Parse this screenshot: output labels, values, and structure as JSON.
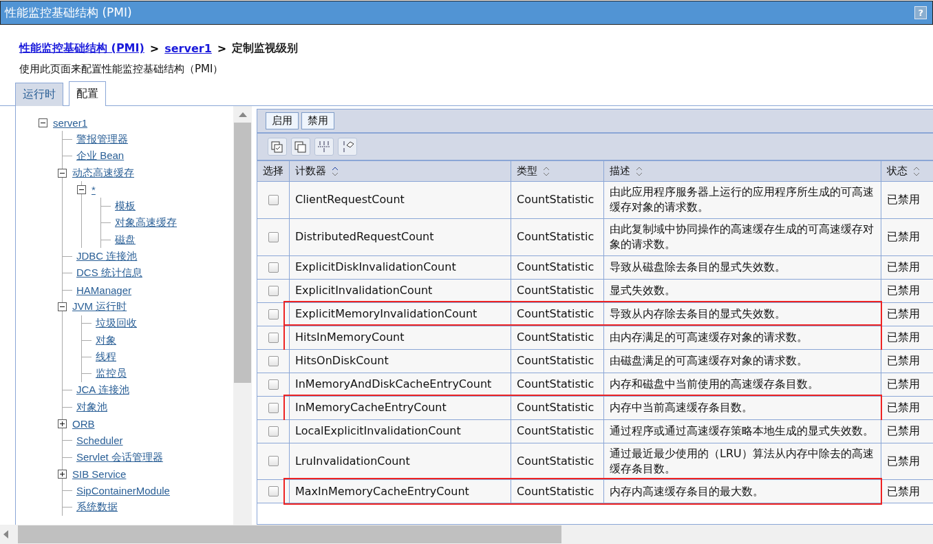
{
  "window": {
    "title": "性能监控基础结构 (PMI)",
    "help": "?"
  },
  "breadcrumb": [
    {
      "label": "性能监控基础结构 (PMI)",
      "link": true
    },
    {
      "label": "server1",
      "link": true
    },
    {
      "label": "定制监视级别",
      "link": false
    }
  ],
  "breadcrumb_separator": ">",
  "description": "使用此页面来配置性能监控基础结构（PMI）",
  "tabs": [
    {
      "label": "运行时",
      "selected": false
    },
    {
      "label": "配置",
      "selected": true
    }
  ],
  "tree": [
    {
      "label": "server1",
      "expanded": true,
      "children": [
        {
          "label": "警报管理器"
        },
        {
          "label": "企业 Bean"
        },
        {
          "label": "动态高速缓存",
          "expanded": true,
          "children": [
            {
              "label": "*",
              "expanded": true,
              "children": [
                {
                  "label": "模板"
                },
                {
                  "label": "对象高速缓存"
                },
                {
                  "label": "磁盘"
                }
              ]
            }
          ]
        },
        {
          "label": "JDBC 连接池"
        },
        {
          "label": "DCS 统计信息"
        },
        {
          "label": "HAManager"
        },
        {
          "label": "JVM 运行时",
          "expanded": true,
          "children": [
            {
              "label": "垃圾回收"
            },
            {
              "label": "对象"
            },
            {
              "label": "线程"
            },
            {
              "label": "监控员"
            }
          ]
        },
        {
          "label": "JCA 连接池"
        },
        {
          "label": "对象池"
        },
        {
          "label": "ORB",
          "expanded": false
        },
        {
          "label": "Scheduler"
        },
        {
          "label": "Servlet 会话管理器"
        },
        {
          "label": "SIB Service",
          "expanded": false
        },
        {
          "label": "SipContainerModule"
        },
        {
          "label": "系统数据"
        }
      ]
    }
  ],
  "buttons": [
    "启用",
    "禁用"
  ],
  "tool_icons": [
    {
      "kind": "select-all"
    },
    {
      "kind": "deselect-all"
    },
    {
      "kind": "expand"
    },
    {
      "kind": "clear"
    }
  ],
  "table": {
    "columns": [
      {
        "label": "选择",
        "sortable": false
      },
      {
        "label": "计数器",
        "sortable": true
      },
      {
        "label": "类型",
        "sortable": true
      },
      {
        "label": "描述",
        "sortable": true
      },
      {
        "label": "状态",
        "sortable": true
      }
    ],
    "rows": [
      {
        "checked": false,
        "outlined": false,
        "counter": "ClientRequestCount",
        "type": "CountStatistic",
        "description": "由此应用程序服务器上运行的应用程序所生成的可高速缓存对象的请求数。",
        "status": "已禁用"
      },
      {
        "checked": false,
        "outlined": false,
        "counter": "DistributedRequestCount",
        "type": "CountStatistic",
        "description": "由此复制域中协同操作的高速缓存生成的可高速缓存对象的请求数。",
        "status": "已禁用"
      },
      {
        "checked": false,
        "outlined": false,
        "counter": "ExplicitDiskInvalidationCount",
        "type": "CountStatistic",
        "description": "导致从磁盘除去条目的显式失效数。",
        "status": "已禁用"
      },
      {
        "checked": false,
        "outlined": false,
        "counter": "ExplicitInvalidationCount",
        "type": "CountStatistic",
        "description": "显式失效数。",
        "status": "已禁用"
      },
      {
        "checked": false,
        "outlined": true,
        "counter": "ExplicitMemoryInvalidationCount",
        "type": "CountStatistic",
        "description": "导致从内存除去条目的显式失效数。",
        "status": "已禁用"
      },
      {
        "checked": false,
        "outlined": true,
        "counter": "HitsInMemoryCount",
        "type": "CountStatistic",
        "description": "由内存满足的可高速缓存对象的请求数。",
        "status": "已禁用"
      },
      {
        "checked": false,
        "outlined": false,
        "counter": "HitsOnDiskCount",
        "type": "CountStatistic",
        "description": "由磁盘满足的可高速缓存对象的请求数。",
        "status": "已禁用"
      },
      {
        "checked": false,
        "outlined": false,
        "counter": "InMemoryAndDiskCacheEntryCount",
        "type": "CountStatistic",
        "description": "内存和磁盘中当前使用的高速缓存条目数。",
        "status": "已禁用"
      },
      {
        "checked": false,
        "outlined": true,
        "counter": "InMemoryCacheEntryCount",
        "type": "CountStatistic",
        "description": "内存中当前高速缓存条目数。",
        "status": "已禁用"
      },
      {
        "checked": false,
        "outlined": false,
        "counter": "LocalExplicitInvalidationCount",
        "type": "CountStatistic",
        "description": "通过程序或通过高速缓存策略本地生成的显式失效数。",
        "status": "已禁用"
      },
      {
        "checked": false,
        "outlined": false,
        "counter": "LruInvalidationCount",
        "type": "CountStatistic",
        "description": "通过最近最少使用的（LRU）算法从内存中除去的高速缓存条目数。",
        "status": "已禁用"
      },
      {
        "checked": false,
        "outlined": true,
        "counter": "MaxInMemoryCacheEntryCount",
        "type": "CountStatistic",
        "description": "内存内高速缓存条目的最大数。",
        "status": "已禁用"
      }
    ]
  }
}
